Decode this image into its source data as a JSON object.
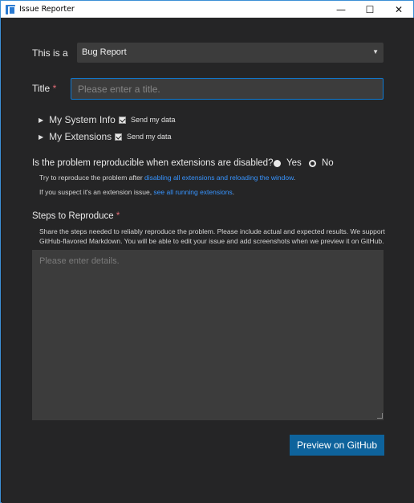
{
  "window": {
    "title": "Issue Reporter",
    "controls": {
      "minimize": "—",
      "maximize": "☐",
      "close": "✕"
    }
  },
  "form": {
    "type_label": "This is a",
    "type_value": "Bug Report",
    "title_label": "Title",
    "required_mark": "*",
    "title_placeholder": "Please enter a title.",
    "system_info_label": "My System Info",
    "extensions_label": "My Extensions",
    "send_data_label": "Send my data",
    "reproducible_question": "Is the problem reproducible when extensions are disabled?",
    "radio_yes": "Yes",
    "radio_no": "No",
    "radio_selected": "No",
    "hint1_prefix": "Try to reproduce the problem after ",
    "hint1_link": "disabling all extensions and reloading the window",
    "hint1_suffix": ".",
    "hint2_prefix": "If you suspect it's an extension issue, ",
    "hint2_link": "see all running extensions",
    "hint2_suffix": ".",
    "steps_label": "Steps to Reproduce",
    "steps_description": "Share the steps needed to reliably reproduce the problem. Please include actual and expected results. We support GitHub-flavored Markdown. You will be able to edit your issue and add screenshots when we preview it on GitHub.",
    "details_placeholder": "Please enter details.",
    "preview_button": "Preview on GitHub"
  },
  "colors": {
    "background": "#252526",
    "accent": "#0e639c",
    "link": "#3794ff",
    "required": "#e06c75"
  }
}
